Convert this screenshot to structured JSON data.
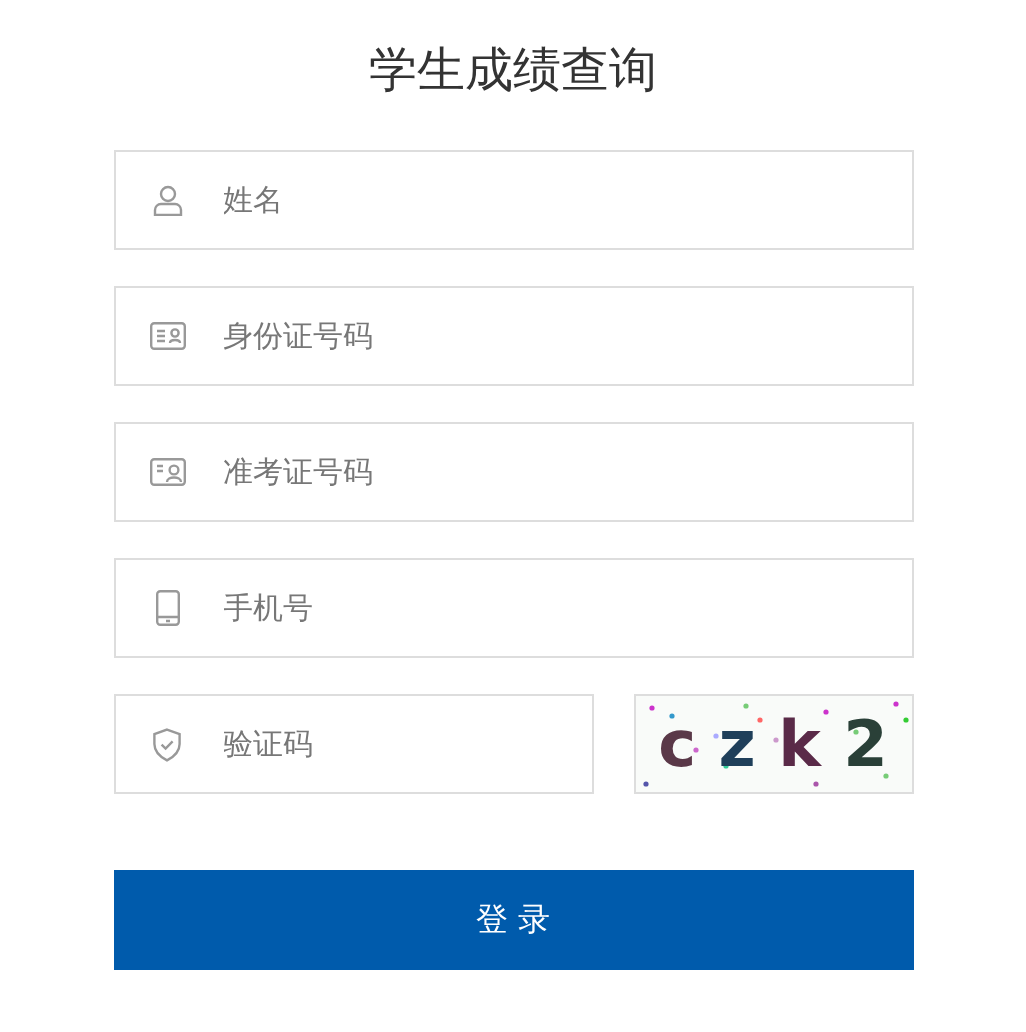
{
  "title": "学生成绩查询",
  "fields": [
    {
      "kind": "person",
      "placeholder": "姓名"
    },
    {
      "kind": "idcard",
      "placeholder": "身份证号码"
    },
    {
      "kind": "examcard",
      "placeholder": "准考证号码"
    },
    {
      "kind": "phone",
      "placeholder": "手机号"
    }
  ],
  "captcha_field": {
    "kind": "shield",
    "placeholder": "验证码"
  },
  "captcha": {
    "characters": [
      {
        "char": "c",
        "color": "#5a3848"
      },
      {
        "char": "z",
        "color": "#1f3f5a"
      },
      {
        "char": "k",
        "color": "#5a2a48"
      },
      {
        "char": "2",
        "color": "#2a4038"
      }
    ]
  },
  "submit": "登 录"
}
